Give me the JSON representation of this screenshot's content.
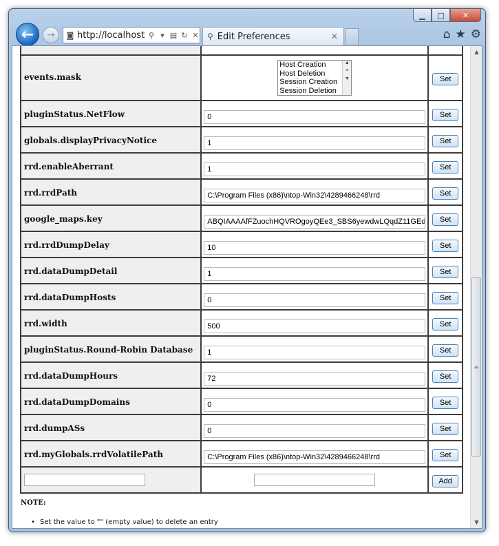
{
  "browser": {
    "url": "http://localhost:",
    "tab_title": "Edit Preferences",
    "icons": [
      "back-arrow-icon",
      "forward-arrow-icon",
      "search-icon",
      "refresh-icon",
      "stop-icon",
      "home-icon",
      "favorites-star-icon",
      "gear-icon"
    ]
  },
  "window_controls": {
    "minimize": "▁",
    "maximize": "□",
    "close": "✕"
  },
  "preferences": [
    {
      "key": "events.mask",
      "type": "list",
      "options": [
        "Host Creation",
        "Host Deletion",
        "Session Creation",
        "Session Deletion"
      ],
      "button": "Set"
    },
    {
      "key": "pluginStatus.NetFlow",
      "value": "0",
      "button": "Set"
    },
    {
      "key": "globals.displayPrivacyNotice",
      "value": "1",
      "button": "Set"
    },
    {
      "key": "rrd.enableAberrant",
      "value": "1",
      "button": "Set"
    },
    {
      "key": "rrd.rrdPath",
      "value": "C:\\Program Files (x86)\\ntop-Win32\\4289466248\\rrd",
      "button": "Set"
    },
    {
      "key": "google_maps.key",
      "value": "ABQIAAAAfFZuochHQVROgoyQEe3_SBS6yewdwLQqdZ11GEd",
      "button": "Set"
    },
    {
      "key": "rrd.rrdDumpDelay",
      "value": "10",
      "button": "Set"
    },
    {
      "key": "rrd.dataDumpDetail",
      "value": "1",
      "button": "Set"
    },
    {
      "key": "rrd.dataDumpHosts",
      "value": "0",
      "button": "Set"
    },
    {
      "key": "rrd.width",
      "value": "500",
      "button": "Set"
    },
    {
      "key": "pluginStatus.Round-Robin Database",
      "value": "1",
      "button": "Set"
    },
    {
      "key": "rrd.dataDumpHours",
      "value": "72",
      "button": "Set"
    },
    {
      "key": "rrd.dataDumpDomains",
      "value": "0",
      "button": "Set"
    },
    {
      "key": "rrd.dumpASs",
      "value": "0",
      "button": "Set"
    },
    {
      "key": "rrd.myGlobals.rrdVolatilePath",
      "value": "C:\\Program Files (x86)\\ntop-Win32\\4289466248\\rrd",
      "button": "Set"
    }
  ],
  "add_row": {
    "key_value": "",
    "value_value": "",
    "button": "Add"
  },
  "note": {
    "title": "NOTE:",
    "items": [
      "Set the value to \"\" (empty value) to delete an entry"
    ]
  }
}
